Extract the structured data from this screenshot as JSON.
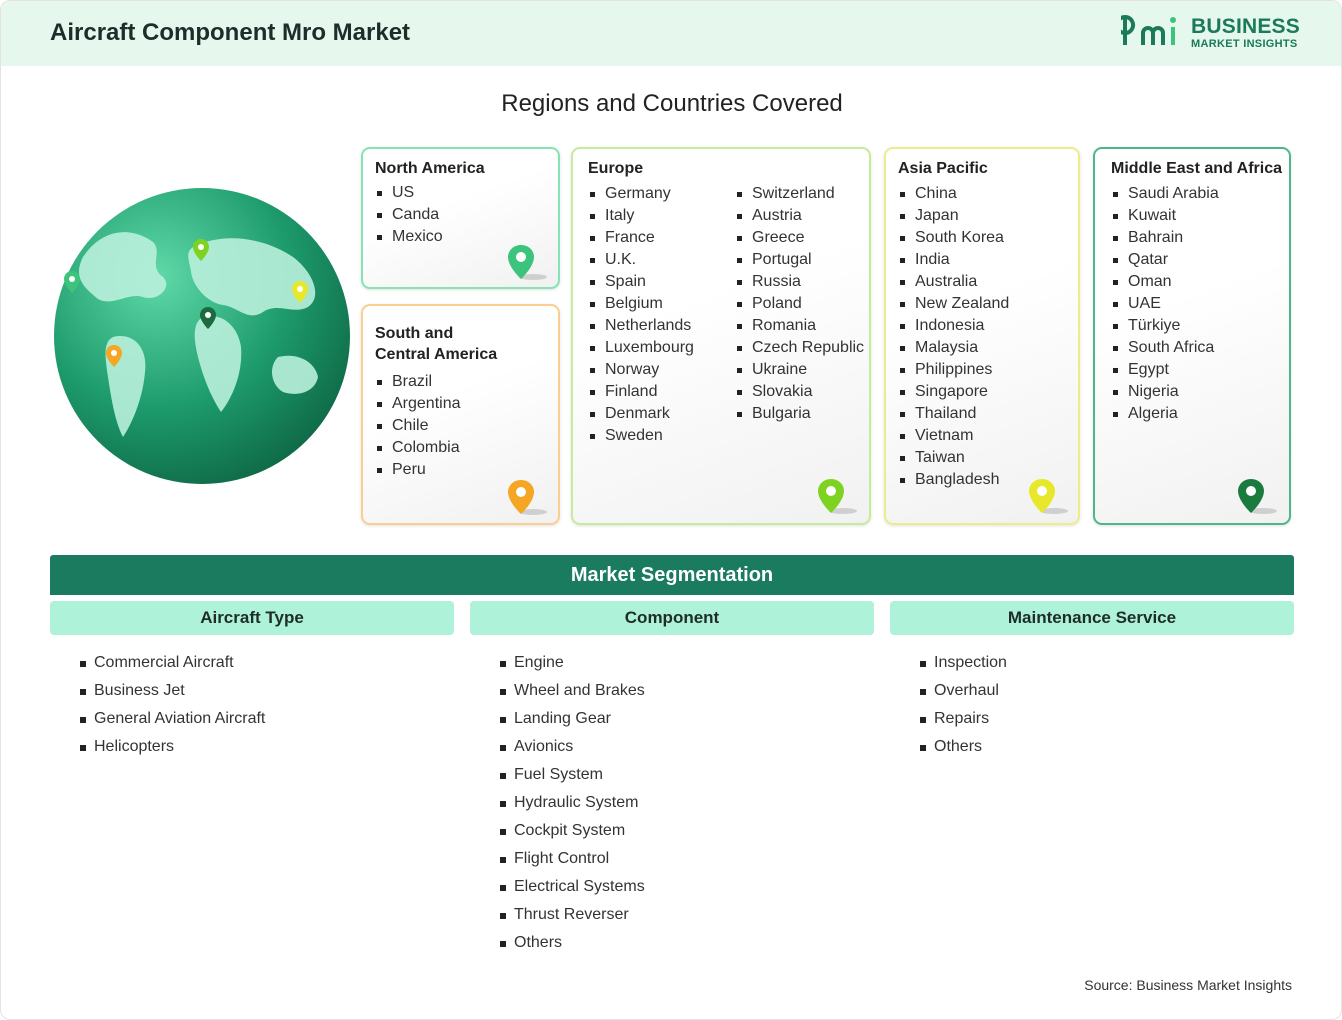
{
  "header": {
    "title": "Aircraft Component Mro Market",
    "logo_big": "BUSINESS",
    "logo_small": "MARKET INSIGHTS"
  },
  "regions_title": "Regions and Countries Covered",
  "regions": {
    "north_america": {
      "title": "North America",
      "countries": [
        "US",
        "Canda",
        "Mexico"
      ],
      "color": "#3cc47c"
    },
    "south_central_america": {
      "title_line1": "South and",
      "title_line2": "Central America",
      "countries": [
        "Brazil",
        "Argentina",
        "Chile",
        "Colombia",
        "Peru"
      ],
      "color": "#f5a623"
    },
    "europe": {
      "title": "Europe",
      "col1": [
        "Germany",
        "Italy",
        "France",
        "U.K.",
        "Spain",
        "Belgium",
        "Netherlands",
        "Luxembourg",
        "Norway",
        "Finland",
        "Denmark",
        "Sweden"
      ],
      "col2": [
        "Switzerland",
        "Austria",
        "Greece",
        "Portugal",
        "Russia",
        "Poland",
        "Romania",
        "Czech Republic",
        "Ukraine",
        "Slovakia",
        "Bulgaria"
      ],
      "color": "#7ed321"
    },
    "asia_pacific": {
      "title": "Asia Pacific",
      "countries": [
        "China",
        "Japan",
        "South Korea",
        "India",
        "Australia",
        "New Zealand",
        "Indonesia",
        "Malaysia",
        "Philippines",
        "Singapore",
        "Thailand",
        "Vietnam",
        "Taiwan",
        "Bangladesh"
      ],
      "color": "#e8e82a"
    },
    "mea": {
      "title": "Middle East and Africa",
      "countries": [
        "Saudi Arabia",
        "Kuwait",
        "Bahrain",
        "Qatar",
        "Oman",
        "UAE",
        "Türkiye",
        "South Africa",
        "Egypt",
        "Nigeria",
        "Algeria"
      ],
      "color": "#1b7b3f"
    }
  },
  "segmentation": {
    "title": "Market Segmentation",
    "columns": [
      {
        "title": "Aircraft Type",
        "items": [
          "Commercial Aircraft",
          "Business Jet",
          "General Aviation Aircraft",
          "Helicopters"
        ]
      },
      {
        "title": "Component",
        "items": [
          "Engine",
          "Wheel and Brakes",
          "Landing Gear",
          "Avionics",
          "Fuel System",
          "Hydraulic System",
          "Cockpit System",
          "Flight Control",
          "Electrical Systems",
          "Thrust Reverser",
          "Others"
        ]
      },
      {
        "title": "Maintenance Service",
        "items": [
          "Inspection",
          "Overhaul",
          "Repairs",
          "Others"
        ]
      }
    ]
  },
  "source": "Source: Business Market Insights"
}
